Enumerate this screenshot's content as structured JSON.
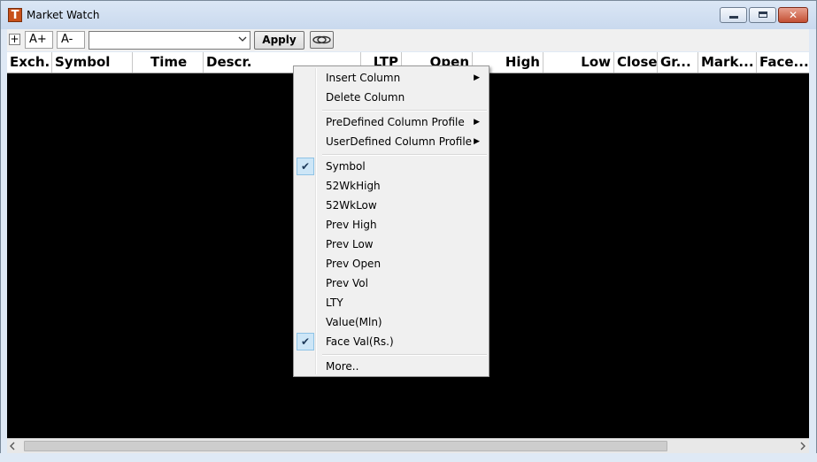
{
  "window": {
    "title": "Market Watch",
    "app_icon_letter": "T",
    "close_glyph": "✕"
  },
  "toolbar": {
    "add_glyph": "+",
    "font_increase": "A+",
    "font_decrease": "A-",
    "profile_value": "",
    "apply_label": "Apply"
  },
  "columns": [
    "Exch.",
    "Symbol",
    "Time",
    "Descr.",
    "LTP",
    "Open",
    "High",
    "Low",
    "Close",
    "Gr...",
    "Mark...",
    "Face..."
  ],
  "context_menu": {
    "items": [
      {
        "label": "Insert Column",
        "submenu": true
      },
      {
        "label": "Delete Column"
      },
      {
        "label": "PreDefined Column Profile",
        "submenu": true
      },
      {
        "label": "UserDefined Column Profile",
        "submenu": true
      },
      {
        "label": "Symbol",
        "checked": true
      },
      {
        "label": "52WkHigh"
      },
      {
        "label": "52WkLow"
      },
      {
        "label": "Prev High"
      },
      {
        "label": "Prev Low"
      },
      {
        "label": "Prev Open"
      },
      {
        "label": "Prev Vol"
      },
      {
        "label": "LTY"
      },
      {
        "label": "Value(Mln)"
      },
      {
        "label": "Face Val(Rs.)",
        "checked": true
      },
      {
        "label": "More.."
      }
    ],
    "check_glyph": "✔",
    "submenu_glyph": "▶"
  },
  "icons": [
    "app-logo-icon",
    "minimize-icon",
    "maximize-icon",
    "close-icon",
    "dropdown-arrow-icon",
    "chain-link-icon",
    "scroll-left-icon",
    "scroll-right-icon",
    "checkmark-icon",
    "submenu-arrow-icon"
  ]
}
